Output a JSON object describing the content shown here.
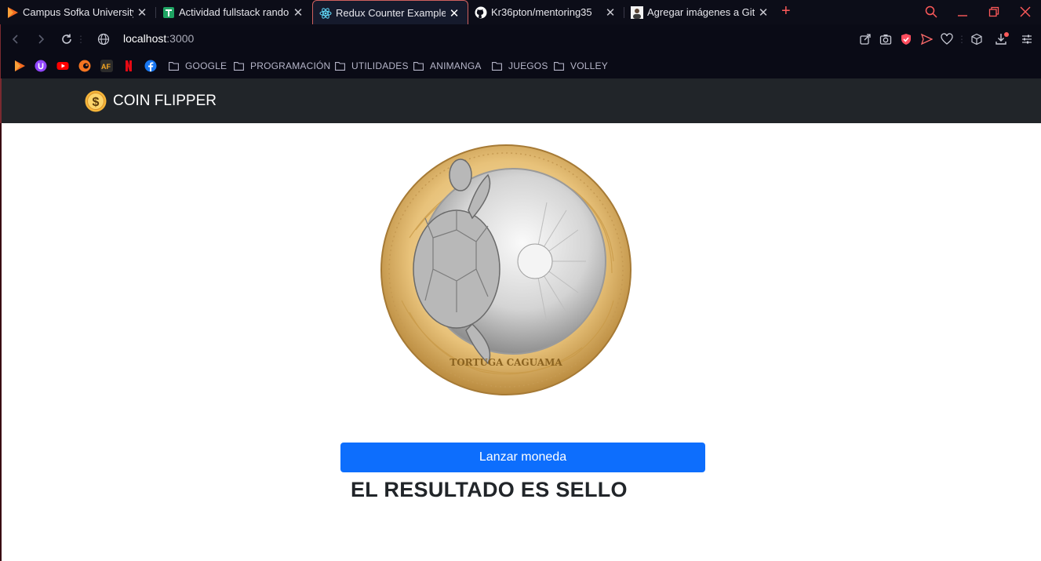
{
  "browser": {
    "tabs": [
      {
        "title": "Campus Sofka University",
        "favicon": "sofka-play-icon",
        "active": false
      },
      {
        "title": "Actividad fullstack random",
        "favicon": "sheets-icon",
        "active": false
      },
      {
        "title": "Redux Counter Example",
        "favicon": "react-icon",
        "active": true
      },
      {
        "title": "Kr36pton/mentoring35",
        "favicon": "github-icon",
        "active": false
      },
      {
        "title": "Agregar imágenes a GitHub",
        "favicon": "avatar-icon",
        "active": false
      }
    ],
    "new_tab_label": "+",
    "address": {
      "host": "localhost",
      "port": ":3000"
    },
    "bookmark_icons": [
      "sofka-play-icon",
      "twitch-u-icon",
      "youtube-icon",
      "crunchyroll-icon",
      "animeflv-icon",
      "netflix-icon",
      "facebook-icon"
    ],
    "bookmark_folders": [
      "GOOGLE",
      "PROGRAMACIÓN",
      "UTILIDADES",
      "ANIMANGA",
      "JUEGOS",
      "VOLLEY"
    ],
    "accent_color": "#ff5a5a"
  },
  "app": {
    "brand": "COIN FLIPPER",
    "brand_icon": "dollar-coin-icon",
    "coin_image": "colombian-500-peso-coin-tails",
    "button_label": "Lanzar moneda",
    "result_text": "EL RESULTADO ES SELLO",
    "colors": {
      "navbar": "#212529",
      "button": "#0d6efd",
      "text": "#212529"
    }
  }
}
